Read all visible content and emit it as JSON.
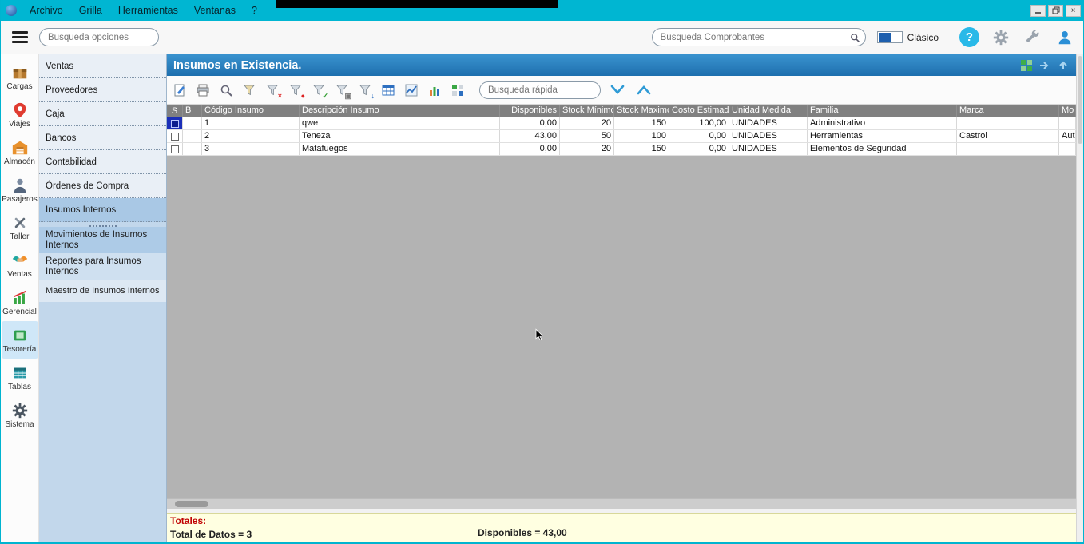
{
  "titlebar": {
    "menus": [
      {
        "label": "Archivo"
      },
      {
        "label": "Grilla"
      },
      {
        "label": "Herramientas"
      },
      {
        "label": "Ventanas"
      },
      {
        "label": "?"
      }
    ],
    "window_controls": [
      "minimize",
      "restore",
      "close"
    ]
  },
  "toolbar": {
    "options_search_placeholder": "Busqueda opciones",
    "comprobantes_search_placeholder": "Busqueda Comprobantes",
    "theme_toggle_label": "Clásico"
  },
  "icons": {
    "hamburger": "menu-bars",
    "search": "magnifier",
    "help": "?",
    "settings": "gear",
    "tools": "wrench",
    "user": "person-silhouette"
  },
  "icon_rail": [
    {
      "label": "Cargas",
      "icon": "package-icon"
    },
    {
      "label": "Viajes",
      "icon": "map-pin-icon"
    },
    {
      "label": "Almacén",
      "icon": "warehouse-icon"
    },
    {
      "label": "Pasajeros",
      "icon": "person-icon"
    },
    {
      "label": "Taller",
      "icon": "tools-icon"
    },
    {
      "label": "Ventas",
      "icon": "handshake-icon"
    },
    {
      "label": "Gerencial",
      "icon": "chart-icon"
    },
    {
      "label": "Tesorería",
      "icon": "cash-icon",
      "selected": true
    },
    {
      "label": "Tablas",
      "icon": "table-icon"
    },
    {
      "label": "Sistema",
      "icon": "gear-icon"
    }
  ],
  "nav": {
    "items": [
      {
        "label": "Ventas"
      },
      {
        "label": "Proveedores"
      },
      {
        "label": "Caja"
      },
      {
        "label": "Bancos"
      },
      {
        "label": "Contabilidad"
      },
      {
        "label": "Órdenes de Compra"
      },
      {
        "label": "Insumos Internos",
        "selected": true
      },
      {
        "label": "Movimientos de Insumos Internos"
      },
      {
        "label": "Reportes para Insumos Internos"
      },
      {
        "label": "Maestro de Insumos Internos"
      }
    ]
  },
  "panel": {
    "title": "Insumos en Existencia.",
    "quick_search_placeholder": "Busqueda rápida"
  },
  "grid": {
    "columns": {
      "s": "S",
      "b": "B",
      "codigo": "Código Insumo",
      "descripcion": "Descripción Insumo",
      "disponibles": "Disponibles",
      "stock_min": "Stock Mínimo",
      "stock_max": "Stock Maximo",
      "costo": "Costo Estimado",
      "unidad": "Unidad Medida",
      "familia": "Familia",
      "marca": "Marca",
      "modelo": "Mo"
    },
    "rows": [
      {
        "codigo": "1",
        "descripcion": "qwe",
        "disponibles": "0,00",
        "stock_min": "20",
        "stock_max": "150",
        "costo": "100,00",
        "unidad": "UNIDADES",
        "familia": "Administrativo",
        "marca": "",
        "modelo": ""
      },
      {
        "codigo": "2",
        "descripcion": "Teneza",
        "disponibles": "43,00",
        "stock_min": "50",
        "stock_max": "100",
        "costo": "0,00",
        "unidad": "UNIDADES",
        "familia": "Herramientas",
        "marca": "Castrol",
        "modelo": "Aut"
      },
      {
        "codigo": "3",
        "descripcion": "Matafuegos",
        "disponibles": "0,00",
        "stock_min": "20",
        "stock_max": "150",
        "costo": "0,00",
        "unidad": "UNIDADES",
        "familia": "Elementos de Seguridad",
        "marca": "",
        "modelo": ""
      }
    ]
  },
  "footer": {
    "totales_label": "Totales:",
    "total_datos": "Total de Datos = 3",
    "disponibles_total": "Disponibles = 43,00"
  }
}
